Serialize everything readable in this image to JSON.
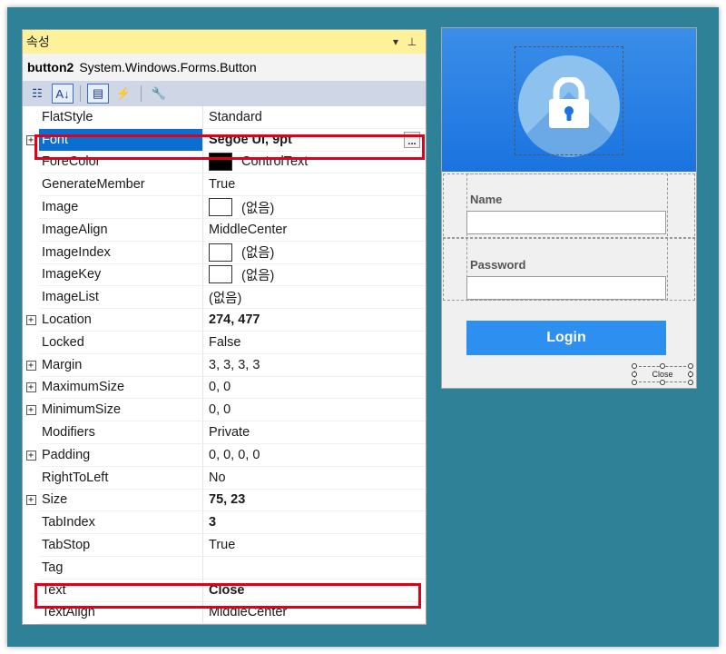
{
  "panel": {
    "title": "속성",
    "title_controls": [
      "▾",
      "⊥"
    ],
    "object_name": "button2",
    "object_type": "System.Windows.Forms.Button",
    "toolbar": [
      {
        "name": "categorized-icon",
        "glyph": "☷"
      },
      {
        "name": "alphabetical-icon",
        "glyph": "A↓"
      },
      {
        "name": "properties-icon",
        "glyph": "▤"
      },
      {
        "name": "events-icon",
        "glyph": "⚡"
      },
      {
        "name": "property-pages-icon",
        "glyph": "🔧"
      }
    ]
  },
  "properties": [
    {
      "name": "FlatStyle",
      "value": "Standard",
      "expand": false
    },
    {
      "name": "Font",
      "value": "Segoe UI, 9pt",
      "expand": true,
      "bold": true,
      "selected": true,
      "ellipsis": true
    },
    {
      "name": "ForeColor",
      "value": "ControlText",
      "expand": false,
      "swatch": "black"
    },
    {
      "name": "GenerateMember",
      "value": "True",
      "expand": false
    },
    {
      "name": "Image",
      "value": "(없음)",
      "expand": false,
      "swatch": "empty"
    },
    {
      "name": "ImageAlign",
      "value": "MiddleCenter",
      "expand": false
    },
    {
      "name": "ImageIndex",
      "value": "(없음)",
      "expand": false,
      "swatch": "empty"
    },
    {
      "name": "ImageKey",
      "value": "(없음)",
      "expand": false,
      "swatch": "empty"
    },
    {
      "name": "ImageList",
      "value": "(없음)",
      "expand": false
    },
    {
      "name": "Location",
      "value": "274, 477",
      "expand": true,
      "bold": true
    },
    {
      "name": "Locked",
      "value": "False",
      "expand": false
    },
    {
      "name": "Margin",
      "value": "3, 3, 3, 3",
      "expand": true
    },
    {
      "name": "MaximumSize",
      "value": "0, 0",
      "expand": true
    },
    {
      "name": "MinimumSize",
      "value": "0, 0",
      "expand": true
    },
    {
      "name": "Modifiers",
      "value": "Private",
      "expand": false
    },
    {
      "name": "Padding",
      "value": "0, 0, 0, 0",
      "expand": true
    },
    {
      "name": "RightToLeft",
      "value": "No",
      "expand": false
    },
    {
      "name": "Size",
      "value": "75, 23",
      "expand": true,
      "bold": true
    },
    {
      "name": "TabIndex",
      "value": "3",
      "expand": false,
      "bold": true
    },
    {
      "name": "TabStop",
      "value": "True",
      "expand": false
    },
    {
      "name": "Tag",
      "value": "",
      "expand": false
    },
    {
      "name": "Text",
      "value": "Close",
      "expand": false,
      "bold": true
    },
    {
      "name": "TextAlign",
      "value": "MiddleCenter",
      "expand": false
    }
  ],
  "form": {
    "name_label": "Name",
    "password_label": "Password",
    "login_label": "Login",
    "close_label": "Close",
    "accent": "#2d8ff0",
    "banner_color": "#1a73e0"
  },
  "colors": {
    "background": "#2e8196",
    "title_bar": "#fdf29a",
    "selection": "#0a6fd1",
    "highlight_box": "#e0001b"
  }
}
